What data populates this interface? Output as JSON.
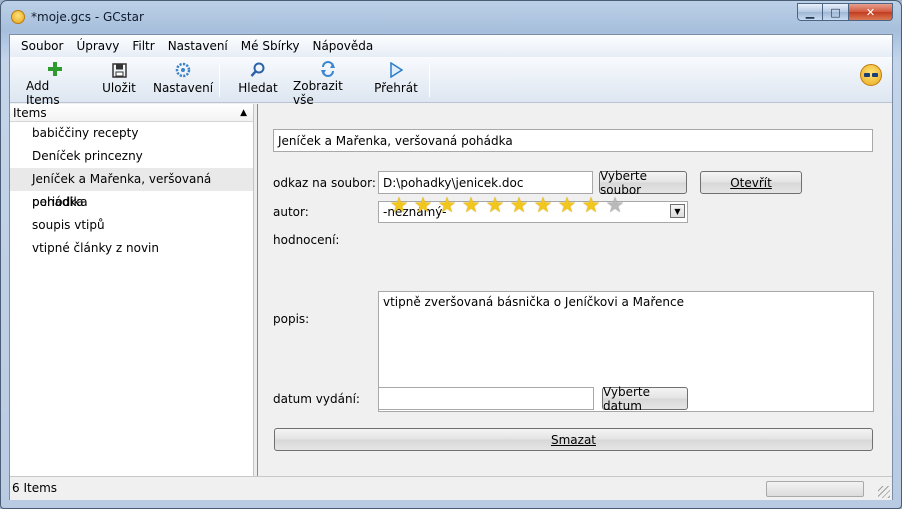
{
  "window": {
    "title": "*moje.gcs - GCstar",
    "minimize": "▁",
    "maximize": "□",
    "close": "✕"
  },
  "menu": [
    "Soubor",
    "Úpravy",
    "Filtr",
    "Nastavení",
    "Mé Sbírky",
    "Nápověda"
  ],
  "toolbar": {
    "buttons": [
      {
        "label": "Add Items",
        "icon": "plus-icon"
      },
      {
        "label": "Uložit",
        "icon": "save-icon"
      },
      {
        "label": "Nastavení",
        "icon": "gear-icon"
      },
      {
        "label": "Hledat",
        "icon": "search-icon"
      },
      {
        "label": "Zobrazit vše",
        "icon": "refresh-icon"
      },
      {
        "label": "Přehrát",
        "icon": "play-icon"
      }
    ]
  },
  "list": {
    "header": "Items",
    "sort_indicator": "▲",
    "items": [
      "babiččiny recepty",
      "Deníček princezny",
      "Jeníček a Mařenka, veršovaná pohádka",
      "periodika",
      "soupis vtipů",
      "vtipné články z novin"
    ],
    "selected_index": 2
  },
  "detail": {
    "title_value": "Jeníček a Mařenka, veršovaná pohádka",
    "file_label": "odkaz na soubor:",
    "file_value": "D:\\pohadky\\jenicek.doc",
    "choose_file_button": "Vyberte soubor",
    "open_button": "Otevřít",
    "author_label": "autor:",
    "author_value": "-neznámý-",
    "rating_label": "hodnocení:",
    "rating": 9,
    "rating_max": 10,
    "star_glyph": "★",
    "desc_label": "popis:",
    "desc_value": "vtipně zveršovaná básnička o Jeníčkovi a Mařence",
    "date_label": "datum vydání:",
    "date_value": "",
    "choose_date_button": "Vyberte datum",
    "delete_button": "Smazat",
    "combo_arrow": "▼"
  },
  "status": {
    "text": "6 Items"
  }
}
